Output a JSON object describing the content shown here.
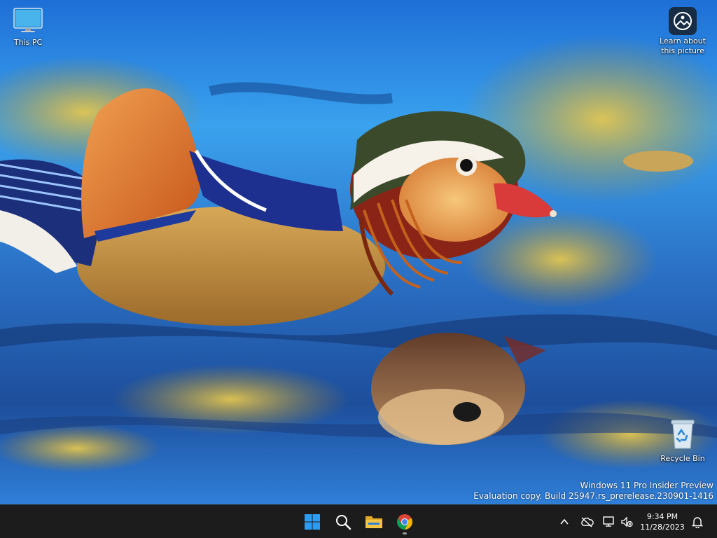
{
  "desktop": {
    "icons": [
      {
        "label": "This PC",
        "icon": "monitor-icon"
      },
      {
        "label": "Learn about this picture",
        "icon": "learn-picture-icon"
      },
      {
        "label": "Recycle Bin",
        "icon": "recycle-bin-icon"
      }
    ],
    "watermark": {
      "line1": "Windows 11 Pro Insider Preview",
      "line2": "Evaluation copy. Build 25947.rs_prerelease.230901-1416"
    }
  },
  "taskbar": {
    "apps": [
      {
        "name": "Start",
        "icon": "windows-logo-icon"
      },
      {
        "name": "Search",
        "icon": "search-icon"
      },
      {
        "name": "File Explorer",
        "icon": "folder-icon"
      },
      {
        "name": "Google Chrome",
        "icon": "chrome-icon",
        "running": true
      }
    ],
    "tray": {
      "icons": [
        "chevron-up-icon",
        "onedrive-icon",
        "network-icon",
        "volume-muted-icon",
        "bell-icon"
      ],
      "time": "9:34 PM",
      "date": "11/28/2023"
    }
  },
  "colors": {
    "taskbar_bg": "#1c1c1c",
    "windows_blue": "#2b9cf2",
    "accent_folder": "#f5c542"
  }
}
